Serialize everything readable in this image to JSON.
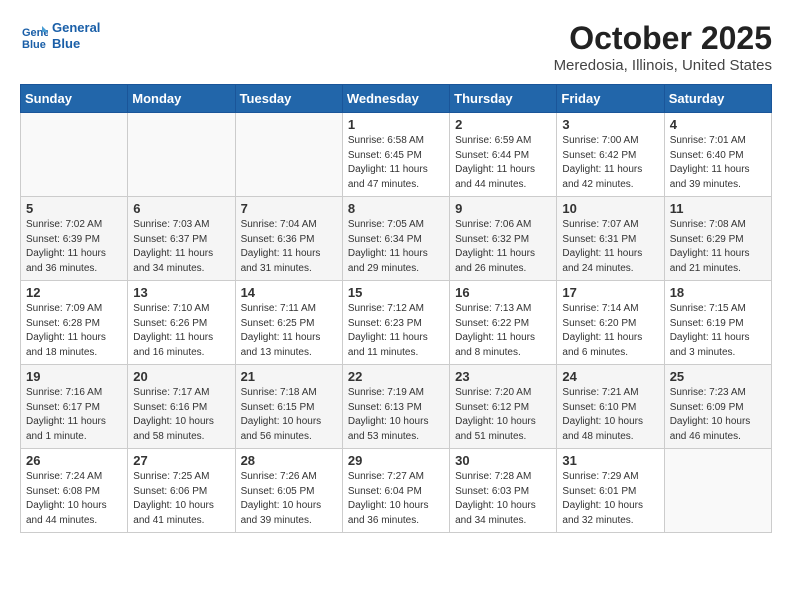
{
  "header": {
    "logo_line1": "General",
    "logo_line2": "Blue",
    "title": "October 2025",
    "subtitle": "Meredosia, Illinois, United States"
  },
  "weekdays": [
    "Sunday",
    "Monday",
    "Tuesday",
    "Wednesday",
    "Thursday",
    "Friday",
    "Saturday"
  ],
  "weeks": [
    [
      {
        "day": "",
        "info": ""
      },
      {
        "day": "",
        "info": ""
      },
      {
        "day": "",
        "info": ""
      },
      {
        "day": "1",
        "info": "Sunrise: 6:58 AM\nSunset: 6:45 PM\nDaylight: 11 hours\nand 47 minutes."
      },
      {
        "day": "2",
        "info": "Sunrise: 6:59 AM\nSunset: 6:44 PM\nDaylight: 11 hours\nand 44 minutes."
      },
      {
        "day": "3",
        "info": "Sunrise: 7:00 AM\nSunset: 6:42 PM\nDaylight: 11 hours\nand 42 minutes."
      },
      {
        "day": "4",
        "info": "Sunrise: 7:01 AM\nSunset: 6:40 PM\nDaylight: 11 hours\nand 39 minutes."
      }
    ],
    [
      {
        "day": "5",
        "info": "Sunrise: 7:02 AM\nSunset: 6:39 PM\nDaylight: 11 hours\nand 36 minutes."
      },
      {
        "day": "6",
        "info": "Sunrise: 7:03 AM\nSunset: 6:37 PM\nDaylight: 11 hours\nand 34 minutes."
      },
      {
        "day": "7",
        "info": "Sunrise: 7:04 AM\nSunset: 6:36 PM\nDaylight: 11 hours\nand 31 minutes."
      },
      {
        "day": "8",
        "info": "Sunrise: 7:05 AM\nSunset: 6:34 PM\nDaylight: 11 hours\nand 29 minutes."
      },
      {
        "day": "9",
        "info": "Sunrise: 7:06 AM\nSunset: 6:32 PM\nDaylight: 11 hours\nand 26 minutes."
      },
      {
        "day": "10",
        "info": "Sunrise: 7:07 AM\nSunset: 6:31 PM\nDaylight: 11 hours\nand 24 minutes."
      },
      {
        "day": "11",
        "info": "Sunrise: 7:08 AM\nSunset: 6:29 PM\nDaylight: 11 hours\nand 21 minutes."
      }
    ],
    [
      {
        "day": "12",
        "info": "Sunrise: 7:09 AM\nSunset: 6:28 PM\nDaylight: 11 hours\nand 18 minutes."
      },
      {
        "day": "13",
        "info": "Sunrise: 7:10 AM\nSunset: 6:26 PM\nDaylight: 11 hours\nand 16 minutes."
      },
      {
        "day": "14",
        "info": "Sunrise: 7:11 AM\nSunset: 6:25 PM\nDaylight: 11 hours\nand 13 minutes."
      },
      {
        "day": "15",
        "info": "Sunrise: 7:12 AM\nSunset: 6:23 PM\nDaylight: 11 hours\nand 11 minutes."
      },
      {
        "day": "16",
        "info": "Sunrise: 7:13 AM\nSunset: 6:22 PM\nDaylight: 11 hours\nand 8 minutes."
      },
      {
        "day": "17",
        "info": "Sunrise: 7:14 AM\nSunset: 6:20 PM\nDaylight: 11 hours\nand 6 minutes."
      },
      {
        "day": "18",
        "info": "Sunrise: 7:15 AM\nSunset: 6:19 PM\nDaylight: 11 hours\nand 3 minutes."
      }
    ],
    [
      {
        "day": "19",
        "info": "Sunrise: 7:16 AM\nSunset: 6:17 PM\nDaylight: 11 hours\nand 1 minute."
      },
      {
        "day": "20",
        "info": "Sunrise: 7:17 AM\nSunset: 6:16 PM\nDaylight: 10 hours\nand 58 minutes."
      },
      {
        "day": "21",
        "info": "Sunrise: 7:18 AM\nSunset: 6:15 PM\nDaylight: 10 hours\nand 56 minutes."
      },
      {
        "day": "22",
        "info": "Sunrise: 7:19 AM\nSunset: 6:13 PM\nDaylight: 10 hours\nand 53 minutes."
      },
      {
        "day": "23",
        "info": "Sunrise: 7:20 AM\nSunset: 6:12 PM\nDaylight: 10 hours\nand 51 minutes."
      },
      {
        "day": "24",
        "info": "Sunrise: 7:21 AM\nSunset: 6:10 PM\nDaylight: 10 hours\nand 48 minutes."
      },
      {
        "day": "25",
        "info": "Sunrise: 7:23 AM\nSunset: 6:09 PM\nDaylight: 10 hours\nand 46 minutes."
      }
    ],
    [
      {
        "day": "26",
        "info": "Sunrise: 7:24 AM\nSunset: 6:08 PM\nDaylight: 10 hours\nand 44 minutes."
      },
      {
        "day": "27",
        "info": "Sunrise: 7:25 AM\nSunset: 6:06 PM\nDaylight: 10 hours\nand 41 minutes."
      },
      {
        "day": "28",
        "info": "Sunrise: 7:26 AM\nSunset: 6:05 PM\nDaylight: 10 hours\nand 39 minutes."
      },
      {
        "day": "29",
        "info": "Sunrise: 7:27 AM\nSunset: 6:04 PM\nDaylight: 10 hours\nand 36 minutes."
      },
      {
        "day": "30",
        "info": "Sunrise: 7:28 AM\nSunset: 6:03 PM\nDaylight: 10 hours\nand 34 minutes."
      },
      {
        "day": "31",
        "info": "Sunrise: 7:29 AM\nSunset: 6:01 PM\nDaylight: 10 hours\nand 32 minutes."
      },
      {
        "day": "",
        "info": ""
      }
    ]
  ]
}
